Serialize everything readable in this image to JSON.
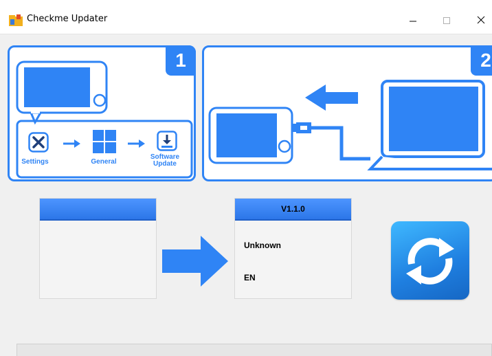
{
  "window": {
    "title": "Checkme Updater",
    "icon": "app-folder-icon",
    "controls": [
      "minimize-icon",
      "maximize-icon",
      "close-icon"
    ]
  },
  "steps": [
    {
      "number": "1",
      "items": [
        {
          "label": "Settings",
          "icon": "wrench-screwdriver-icon"
        },
        {
          "label": "General",
          "icon": "windows-grid-icon"
        },
        {
          "label": "Software Update",
          "label_line1": "Software",
          "label_line2": "Update",
          "icon": "download-icon"
        }
      ]
    },
    {
      "number": "2",
      "icons": [
        "device-icon",
        "usb-cable-icon",
        "arrow-left-icon",
        "laptop-icon"
      ]
    }
  ],
  "device_box": {
    "header": ""
  },
  "update_box": {
    "header": "V1.1.0",
    "line1": "Unknown",
    "line2": "EN"
  },
  "refresh": {
    "icon": "refresh-icon"
  },
  "colors": {
    "accent": "#2f84f5",
    "header_blue": "#3b86f5",
    "refresh_top": "#3fb8ff",
    "refresh_bottom": "#1667c4"
  }
}
